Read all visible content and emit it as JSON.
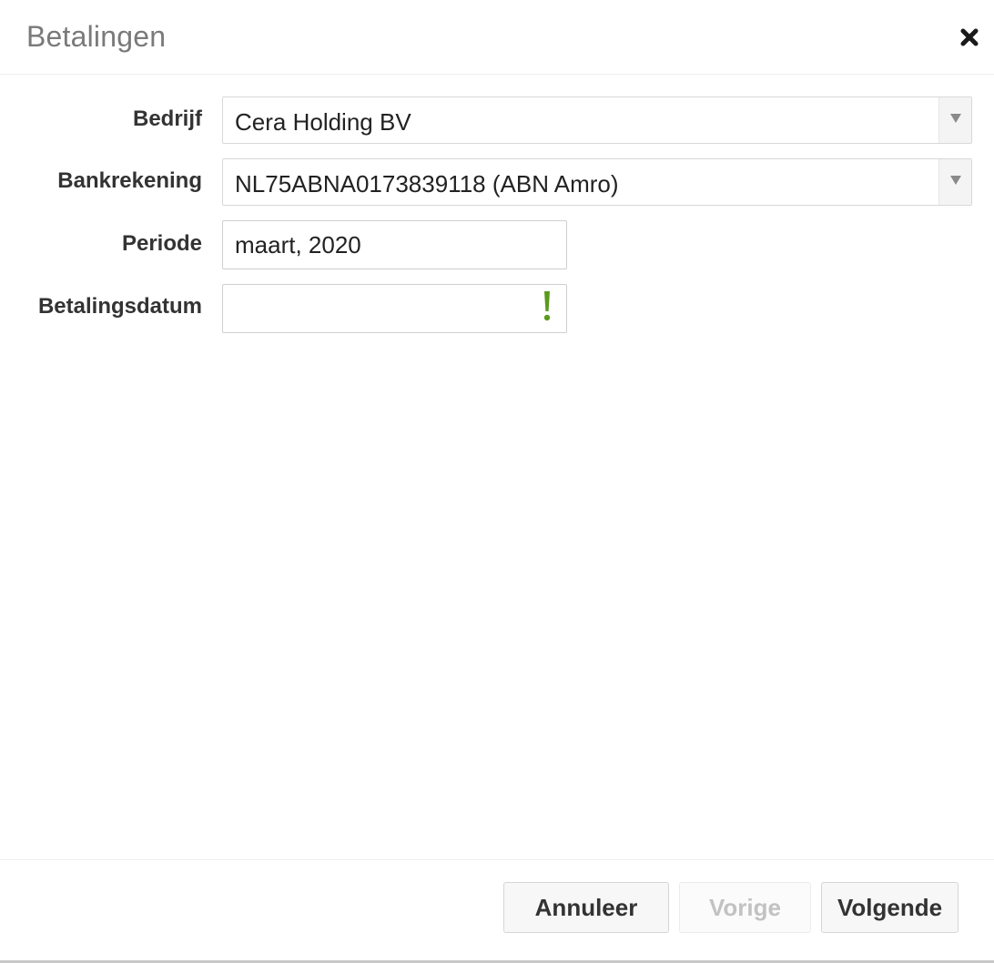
{
  "dialog": {
    "title": "Betalingen",
    "close_icon": "close-icon"
  },
  "form": {
    "bedrijf": {
      "label": "Bedrijf",
      "value": "Cera Holding BV"
    },
    "bankrekening": {
      "label": "Bankrekening",
      "value": "NL75ABNA0173839118 (ABN Amro)"
    },
    "periode": {
      "label": "Periode",
      "value": "maart, 2020"
    },
    "betalingsdatum": {
      "label": "Betalingsdatum",
      "value": "",
      "status_icon": "warning-icon",
      "status_color": "#5a9a1c"
    }
  },
  "footer": {
    "cancel_label": "Annuleer",
    "prev_label": "Vorige",
    "next_label": "Volgende"
  }
}
